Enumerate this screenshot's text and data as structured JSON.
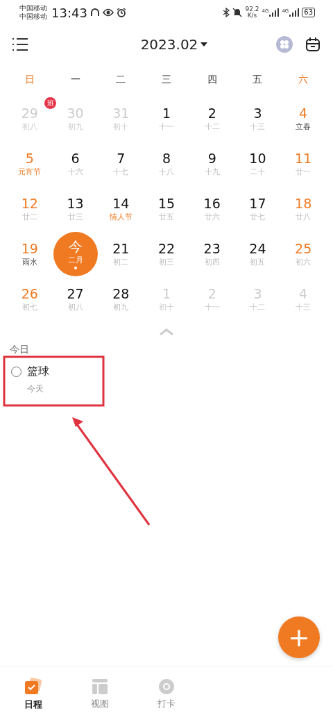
{
  "status_bar": {
    "carriers": [
      "中国移动",
      "中国移动"
    ],
    "time": "13:43",
    "speed_value": "92.2",
    "speed_unit": "K/s",
    "networks": [
      "4G",
      "4G"
    ],
    "battery": "63"
  },
  "header": {
    "month": "2023.02"
  },
  "weekdays": [
    {
      "label": "日",
      "weekend": true
    },
    {
      "label": "一",
      "weekend": false
    },
    {
      "label": "二",
      "weekend": false
    },
    {
      "label": "三",
      "weekend": false
    },
    {
      "label": "四",
      "weekend": false
    },
    {
      "label": "五",
      "weekend": false
    },
    {
      "label": "六",
      "weekend": true
    }
  ],
  "weeks": [
    [
      {
        "day": "29",
        "sub": "初八",
        "kind": "other",
        "festival": false,
        "solar_term": false,
        "badge": "班",
        "selected": false
      },
      {
        "day": "30",
        "sub": "初九",
        "kind": "other",
        "festival": false,
        "solar_term": false,
        "selected": false
      },
      {
        "day": "31",
        "sub": "初十",
        "kind": "other",
        "festival": false,
        "solar_term": false,
        "selected": false
      },
      {
        "day": "1",
        "sub": "十一",
        "kind": "weekday",
        "festival": false,
        "solar_term": false,
        "selected": false
      },
      {
        "day": "2",
        "sub": "十二",
        "kind": "weekday",
        "festival": false,
        "solar_term": false,
        "selected": false
      },
      {
        "day": "3",
        "sub": "十三",
        "kind": "weekday",
        "festival": false,
        "solar_term": false,
        "selected": false
      },
      {
        "day": "4",
        "sub": "立春",
        "kind": "weekend",
        "festival": false,
        "solar_term": true,
        "selected": false
      }
    ],
    [
      {
        "day": "5",
        "sub": "元宵节",
        "kind": "weekend",
        "festival": true,
        "solar_term": false,
        "selected": false
      },
      {
        "day": "6",
        "sub": "十六",
        "kind": "weekday",
        "festival": false,
        "solar_term": false,
        "selected": false
      },
      {
        "day": "7",
        "sub": "十七",
        "kind": "weekday",
        "festival": false,
        "solar_term": false,
        "selected": false
      },
      {
        "day": "8",
        "sub": "十八",
        "kind": "weekday",
        "festival": false,
        "solar_term": false,
        "selected": false
      },
      {
        "day": "9",
        "sub": "十九",
        "kind": "weekday",
        "festival": false,
        "solar_term": false,
        "selected": false
      },
      {
        "day": "10",
        "sub": "二十",
        "kind": "weekday",
        "festival": false,
        "solar_term": false,
        "selected": false
      },
      {
        "day": "11",
        "sub": "廿一",
        "kind": "weekend",
        "festival": false,
        "solar_term": false,
        "selected": false
      }
    ],
    [
      {
        "day": "12",
        "sub": "廿二",
        "kind": "weekend",
        "festival": false,
        "solar_term": false,
        "selected": false
      },
      {
        "day": "13",
        "sub": "廿三",
        "kind": "weekday",
        "festival": false,
        "solar_term": false,
        "selected": false
      },
      {
        "day": "14",
        "sub": "情人节",
        "kind": "weekday",
        "festival": true,
        "solar_term": false,
        "selected": false
      },
      {
        "day": "15",
        "sub": "廿五",
        "kind": "weekday",
        "festival": false,
        "solar_term": false,
        "selected": false
      },
      {
        "day": "16",
        "sub": "廿六",
        "kind": "weekday",
        "festival": false,
        "solar_term": false,
        "selected": false
      },
      {
        "day": "17",
        "sub": "廿七",
        "kind": "weekday",
        "festival": false,
        "solar_term": false,
        "selected": false
      },
      {
        "day": "18",
        "sub": "廿八",
        "kind": "weekend",
        "festival": false,
        "solar_term": false,
        "selected": false
      }
    ],
    [
      {
        "day": "19",
        "sub": "雨水",
        "kind": "weekend",
        "festival": false,
        "solar_term": true,
        "selected": false
      },
      {
        "day": "今",
        "sub": "二月",
        "kind": "weekday",
        "festival": false,
        "solar_term": false,
        "selected": true,
        "has_event": true
      },
      {
        "day": "21",
        "sub": "初二",
        "kind": "weekday",
        "festival": false,
        "solar_term": false,
        "selected": false
      },
      {
        "day": "22",
        "sub": "初三",
        "kind": "weekday",
        "festival": false,
        "solar_term": false,
        "selected": false
      },
      {
        "day": "23",
        "sub": "初四",
        "kind": "weekday",
        "festival": false,
        "solar_term": false,
        "selected": false
      },
      {
        "day": "24",
        "sub": "初五",
        "kind": "weekday",
        "festival": false,
        "solar_term": false,
        "selected": false
      },
      {
        "day": "25",
        "sub": "初六",
        "kind": "weekend",
        "festival": false,
        "solar_term": false,
        "selected": false
      }
    ],
    [
      {
        "day": "26",
        "sub": "初七",
        "kind": "weekend",
        "festival": false,
        "solar_term": false,
        "selected": false
      },
      {
        "day": "27",
        "sub": "初八",
        "kind": "weekday",
        "festival": false,
        "solar_term": false,
        "selected": false
      },
      {
        "day": "28",
        "sub": "初九",
        "kind": "weekday",
        "festival": false,
        "solar_term": false,
        "selected": false
      },
      {
        "day": "1",
        "sub": "初十",
        "kind": "other",
        "festival": false,
        "solar_term": false,
        "selected": false
      },
      {
        "day": "2",
        "sub": "十一",
        "kind": "other",
        "festival": false,
        "solar_term": false,
        "selected": false
      },
      {
        "day": "3",
        "sub": "十二",
        "kind": "other",
        "festival": false,
        "solar_term": false,
        "selected": false
      },
      {
        "day": "4",
        "sub": "十三",
        "kind": "other",
        "festival": false,
        "solar_term": false,
        "selected": false
      }
    ]
  ],
  "agenda": {
    "heading": "今日",
    "tasks": [
      {
        "title": "篮球",
        "date": "今天",
        "checked": false
      }
    ]
  },
  "fab": {
    "label": "+"
  },
  "nav": [
    {
      "label": "日程",
      "kind": "schedule",
      "selected": true
    },
    {
      "label": "视图",
      "kind": "view",
      "selected": false
    },
    {
      "label": "打卡",
      "kind": "checkin",
      "selected": false
    }
  ]
}
